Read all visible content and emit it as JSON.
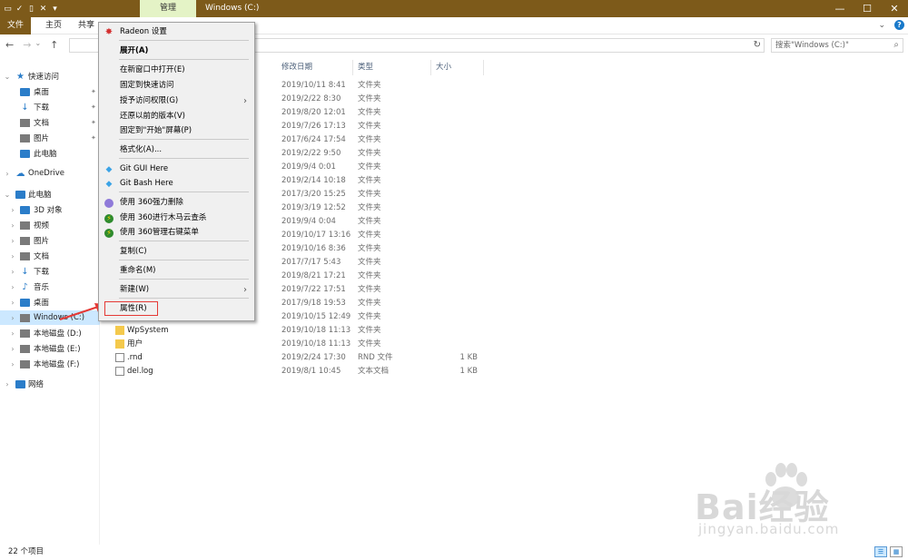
{
  "window": {
    "title": "Windows (C:)",
    "context_tab": "管理",
    "controls": [
      "—",
      "☐",
      "✕"
    ]
  },
  "ribbon": {
    "tabs": [
      "文件",
      "主页",
      "共享"
    ],
    "help": "?"
  },
  "search": {
    "placeholder": "搜索\"Windows (C:)\""
  },
  "nav": {
    "items": [
      {
        "label": "快速访问",
        "icon": "star-icon"
      },
      {
        "label": "桌面",
        "icon": "desktop-icon"
      },
      {
        "label": "下载",
        "icon": "download-icon"
      },
      {
        "label": "文档",
        "icon": "document-icon"
      },
      {
        "label": "图片",
        "icon": "picture-icon"
      },
      {
        "label": "此电脑",
        "icon": "computer-icon"
      },
      {
        "label": "OneDrive",
        "icon": "cloud-icon"
      },
      {
        "label": "此电脑",
        "icon": "computer-icon"
      },
      {
        "label": "3D 对象",
        "icon": "cube-icon"
      },
      {
        "label": "视频",
        "icon": "video-icon"
      },
      {
        "label": "图片",
        "icon": "picture-icon"
      },
      {
        "label": "文档",
        "icon": "document-icon"
      },
      {
        "label": "下载",
        "icon": "download-icon"
      },
      {
        "label": "音乐",
        "icon": "music-icon"
      },
      {
        "label": "桌面",
        "icon": "desktop-icon"
      },
      {
        "label": "Windows (C:)",
        "icon": "drive-icon"
      },
      {
        "label": "本地磁盘 (D:)",
        "icon": "drive-icon"
      },
      {
        "label": "本地磁盘 (E:)",
        "icon": "drive-icon"
      },
      {
        "label": "本地磁盘 (F:)",
        "icon": "drive-icon"
      },
      {
        "label": "网络",
        "icon": "network-icon"
      }
    ]
  },
  "columns": {
    "date": "修改日期",
    "type": "类型",
    "size": "大小"
  },
  "files": [
    {
      "name": "",
      "date": "2019/10/11 8:41",
      "type": "文件夹",
      "size": ""
    },
    {
      "name": "",
      "date": "2019/2/22 8:30",
      "type": "文件夹",
      "size": ""
    },
    {
      "name": "",
      "date": "2019/8/20 12:01",
      "type": "文件夹",
      "size": ""
    },
    {
      "name": "",
      "date": "2019/7/26 17:13",
      "type": "文件夹",
      "size": ""
    },
    {
      "name": "",
      "date": "2017/6/24 17:54",
      "type": "文件夹",
      "size": ""
    },
    {
      "name": "",
      "date": "2019/2/22 9:50",
      "type": "文件夹",
      "size": ""
    },
    {
      "name": "",
      "date": "2019/9/4 0:01",
      "type": "文件夹",
      "size": ""
    },
    {
      "name": "",
      "date": "2019/2/14 10:18",
      "type": "文件夹",
      "size": ""
    },
    {
      "name": "",
      "date": "2017/3/20 15:25",
      "type": "文件夹",
      "size": ""
    },
    {
      "name": "",
      "date": "2019/3/19 12:52",
      "type": "文件夹",
      "size": ""
    },
    {
      "name": "",
      "date": "2019/9/4 0:04",
      "type": "文件夹",
      "size": ""
    },
    {
      "name": "",
      "date": "2019/10/17 13:16",
      "type": "文件夹",
      "size": ""
    },
    {
      "name": "",
      "date": "2019/10/16 8:36",
      "type": "文件夹",
      "size": ""
    },
    {
      "name": "",
      "date": "2017/7/17 5:43",
      "type": "文件夹",
      "size": ""
    },
    {
      "name": "",
      "date": "2019/8/21 17:21",
      "type": "文件夹",
      "size": ""
    },
    {
      "name": "",
      "date": "2019/7/22 17:51",
      "type": "文件夹",
      "size": ""
    },
    {
      "name": "",
      "date": "2017/9/18 19:53",
      "type": "文件夹",
      "size": ""
    },
    {
      "name": "",
      "date": "2019/10/15 12:49",
      "type": "文件夹",
      "size": ""
    },
    {
      "name": "WpSystem",
      "date": "2019/10/18 11:13",
      "type": "文件夹",
      "size": ""
    },
    {
      "name": "用户",
      "date": "2019/10/18 11:13",
      "type": "文件夹",
      "size": ""
    },
    {
      "name": ".rnd",
      "date": "2019/2/24 17:30",
      "type": "RND 文件",
      "size": "1 KB"
    },
    {
      "name": "del.log",
      "date": "2019/8/1 10:45",
      "type": "文本文档",
      "size": "1 KB"
    }
  ],
  "context_menu": {
    "items": [
      {
        "label": "Radeon 设置",
        "icon": "radeon-icon"
      },
      {
        "label": "展开(A)",
        "bold": true
      },
      {
        "label": "在新窗口中打开(E)"
      },
      {
        "label": "固定到快速访问"
      },
      {
        "label": "授予访问权限(G)",
        "submenu": true
      },
      {
        "label": "还原以前的版本(V)"
      },
      {
        "label": "固定到\"开始\"屏幕(P)"
      },
      {
        "label": "格式化(A)..."
      },
      {
        "label": "Git GUI Here",
        "icon": "git-icon"
      },
      {
        "label": "Git Bash Here",
        "icon": "git-icon"
      },
      {
        "label": "使用 360强力删除",
        "icon": "360-delete-icon"
      },
      {
        "label": "使用 360进行木马云查杀",
        "icon": "360-scan-icon"
      },
      {
        "label": "使用 360管理右键菜单",
        "icon": "360-menu-icon"
      },
      {
        "label": "复制(C)"
      },
      {
        "label": "重命名(M)"
      },
      {
        "label": "新建(W)",
        "submenu": true
      },
      {
        "label": "属性(R)"
      }
    ]
  },
  "status": {
    "count": "22 个项目"
  },
  "watermark": {
    "brand": "Bai经验",
    "url": "jingyan.baidu.com"
  },
  "colors": {
    "titlebar": "#7d5a1a",
    "context_tab": "#e4f3c6",
    "highlight_box": "#e53935",
    "selection": "#cce8ff"
  }
}
